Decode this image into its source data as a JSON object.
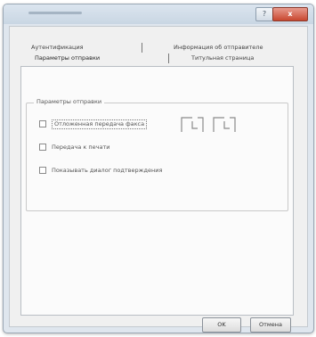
{
  "titlebar": {
    "help_label": "?",
    "close_label": "x"
  },
  "tabs": {
    "row1": [
      {
        "label": "Аутентификация"
      },
      {
        "label": "Информация об отправителе"
      }
    ],
    "row2": [
      {
        "label": "Параметры отправки"
      },
      {
        "label": "Титульная страница"
      }
    ]
  },
  "group": {
    "legend": "Параметры отправки",
    "options": [
      {
        "label": "Отложенная передача факса",
        "checked": false
      },
      {
        "label": "Передача к печати",
        "checked": false
      },
      {
        "label": "Показывать диалог подтверждения",
        "checked": false
      }
    ]
  },
  "footer": {
    "ok_label": "OK",
    "cancel_label": "Отмена"
  }
}
